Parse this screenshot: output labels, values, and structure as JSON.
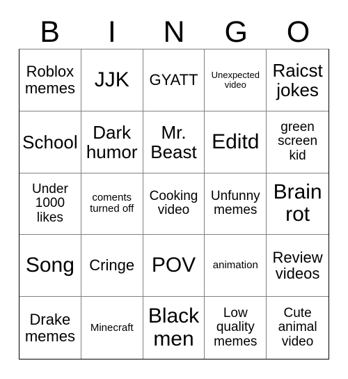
{
  "card": {
    "title": "BINGO",
    "header_letters": [
      "B",
      "I",
      "N",
      "G",
      "O"
    ],
    "rows": [
      [
        {
          "text": "Roblox memes",
          "size": "sz-md"
        },
        {
          "text": "JJK",
          "size": "sz-xl"
        },
        {
          "text": "GYATT",
          "size": "sz-md"
        },
        {
          "text": "Unexpected video",
          "size": "sz-xxs"
        },
        {
          "text": "Raicst jokes",
          "size": "sz-lg"
        }
      ],
      [
        {
          "text": "School",
          "size": "sz-lg"
        },
        {
          "text": "Dark humor",
          "size": "sz-lg"
        },
        {
          "text": "Mr. Beast",
          "size": "sz-lg"
        },
        {
          "text": "Editd",
          "size": "sz-xl"
        },
        {
          "text": "green screen kid",
          "size": "sz-sm"
        }
      ],
      [
        {
          "text": "Under 1000 likes",
          "size": "sz-sm"
        },
        {
          "text": "coments turned off",
          "size": "sz-xs"
        },
        {
          "text": "Cooking video",
          "size": "sz-sm"
        },
        {
          "text": "Unfunny memes",
          "size": "sz-sm"
        },
        {
          "text": "Brain rot",
          "size": "sz-xl"
        }
      ],
      [
        {
          "text": "Song",
          "size": "sz-xl"
        },
        {
          "text": "Cringe",
          "size": "sz-md"
        },
        {
          "text": "POV",
          "size": "sz-xl"
        },
        {
          "text": "animation",
          "size": "sz-xs"
        },
        {
          "text": "Review videos",
          "size": "sz-md"
        }
      ],
      [
        {
          "text": "Drake memes",
          "size": "sz-md"
        },
        {
          "text": "Minecraft",
          "size": "sz-xs"
        },
        {
          "text": "Black men",
          "size": "sz-xl"
        },
        {
          "text": "Low quality memes",
          "size": "sz-sm"
        },
        {
          "text": "Cute animal video",
          "size": "sz-sm"
        }
      ]
    ],
    "colors": {
      "background": "#ffffff",
      "text": "#000000",
      "grid_line": "#808080",
      "grid_outline": "#000000"
    }
  }
}
